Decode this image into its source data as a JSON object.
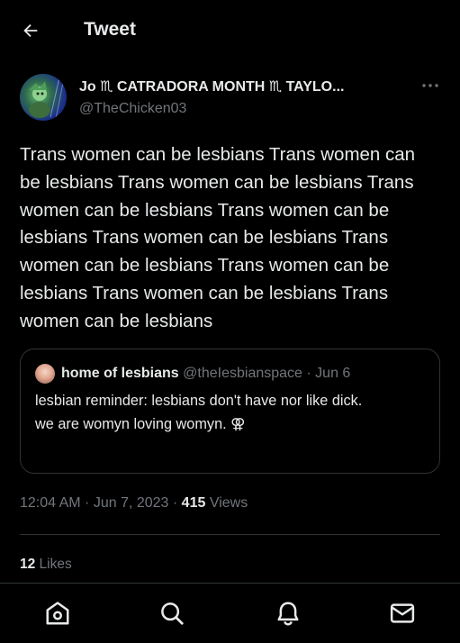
{
  "header": {
    "title": "Tweet"
  },
  "tweet": {
    "author": {
      "display_name": "Jo ♏ CATRADORA MONTH ♏ TAYLO...",
      "handle": "@TheChicken03"
    },
    "text": "Trans women can be lesbians Trans women can be lesbians Trans women can be lesbians Trans women can be lesbians Trans women can be lesbians Trans women can be lesbians Trans women can be lesbians Trans women can be lesbians Trans women can be lesbians Trans women can be lesbians",
    "quote": {
      "name": "home of lesbians",
      "handle": "@theIesbianspace",
      "separator": "·",
      "date": "Jun 6",
      "text": "lesbian reminder: lesbians don't have nor like dick.\nwe are womyn loving womyn. ⚢"
    },
    "meta": {
      "time": "12:04 AM",
      "sep1": " · ",
      "date": "Jun 7, 2023",
      "sep2": " · ",
      "views_count": "415",
      "views_label": " Views"
    },
    "likes": {
      "count": "12",
      "label": " Likes"
    }
  },
  "colors": {
    "background": "#000000",
    "text_primary": "#e7e9ea",
    "text_secondary": "#71767b",
    "border": "#2f3336"
  },
  "icons": {
    "back": "arrow-left-icon",
    "more": "more-horizontal-icon",
    "home": "home-icon",
    "search": "search-icon",
    "notifications": "bell-icon",
    "messages": "mail-icon"
  }
}
